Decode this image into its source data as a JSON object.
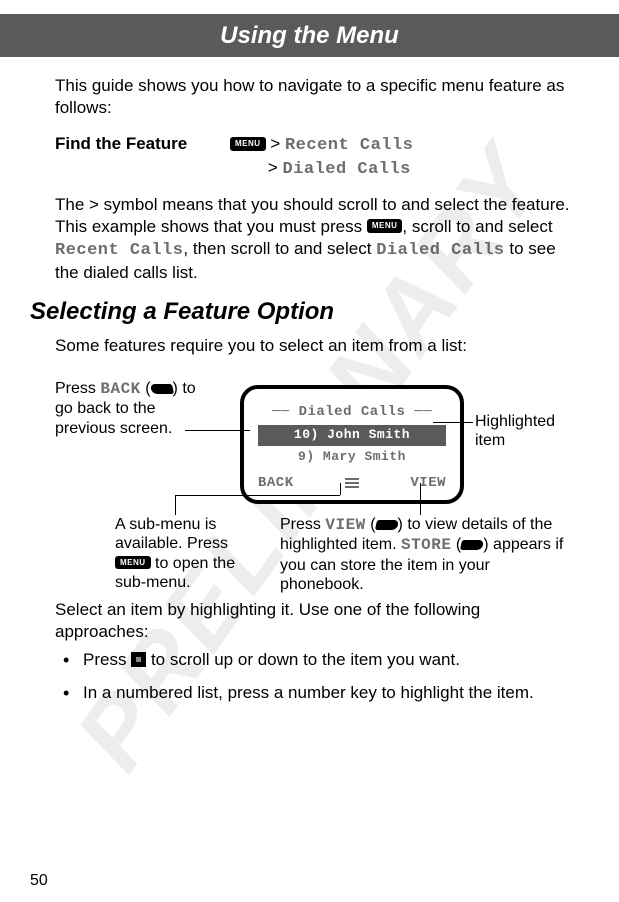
{
  "watermark": "PRELIMINARY",
  "header": "Using the Menu",
  "intro": "This guide shows you how to navigate to a specific menu feature as follows:",
  "find_feature": {
    "label": "Find the Feature",
    "path1_prefix": ">",
    "path1": "Recent Calls",
    "path2_prefix": ">",
    "path2": "Dialed Calls"
  },
  "explain": "The > symbol means that you should scroll to and select the feature. This example shows that you must press",
  "explain2": ", scroll to and select",
  "explain_code1": "Recent Calls",
  "explain3": ", then scroll to and select",
  "explain_code2": "Dialed Calls",
  "explain4": "to see the dialed calls list.",
  "section_head": "Selecting a Feature Option",
  "section_intro": "Some features require you to select an item from a list:",
  "diagram": {
    "left_callout_a": "Press",
    "left_callout_code": "BACK",
    "left_callout_b": "to go back to the previous screen.",
    "right_callout": "Highlighted item",
    "bl_a": "A sub-menu is available. Press",
    "bl_b": "to open the sub-menu.",
    "br_a": "Press",
    "br_code1": "VIEW",
    "br_b": "to view details of the highlighted item.",
    "br_code2": "STORE",
    "br_c": "appears if you can store the item in your phonebook.",
    "screen": {
      "title": "Dialed Calls",
      "row1": "10) John Smith",
      "row2": "9) Mary Smith",
      "soft_left": "BACK",
      "soft_right": "VIEW"
    }
  },
  "after_diagram": "Select an item by highlighting it. Use one of the following approaches:",
  "bullets": {
    "b1a": "Press",
    "b1b": "to scroll up or down to the item you want.",
    "b2": "In a numbered list, press a number key to highlight the item."
  },
  "page_number": "50",
  "menu_label": "MENU"
}
